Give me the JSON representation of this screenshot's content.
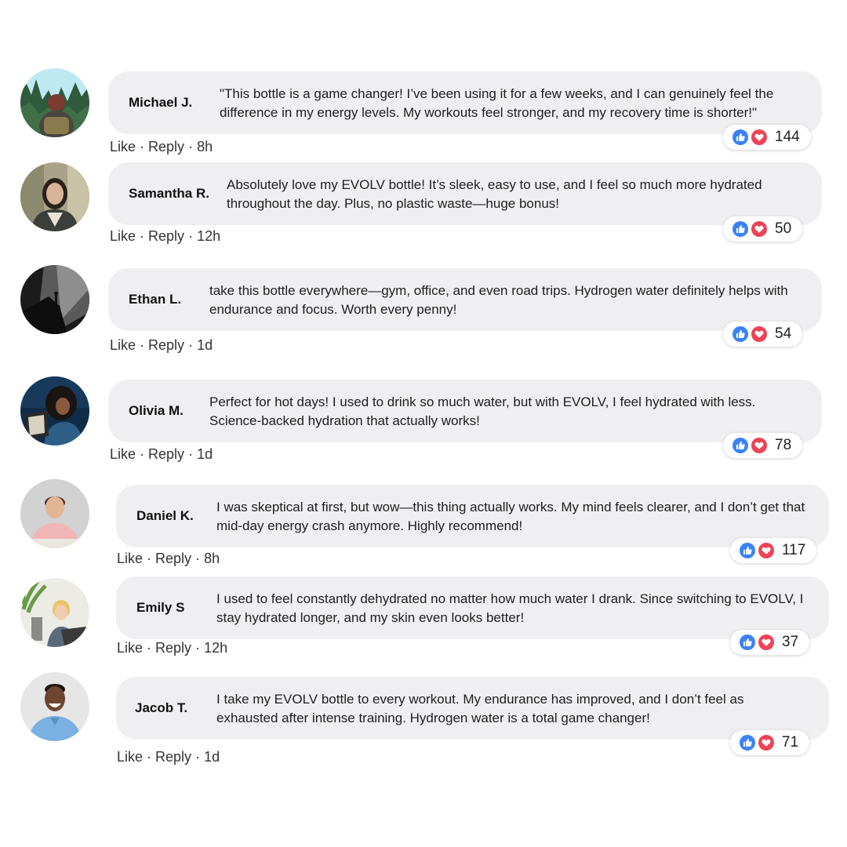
{
  "colors": {
    "bubble": "#efeff1",
    "like": "#3b82f6",
    "heart": "#ef4256"
  },
  "comments": [
    {
      "name": "Michael J.",
      "text": "\"This bottle is a game changer! I’ve been using it for a few weeks, and I can genuinely feel the difference in my energy levels. My workouts feel stronger, and my recovery time is shorter!\"",
      "like": "Like",
      "reply": "Reply",
      "time": "8h",
      "reactions": 144,
      "avatar": "hiker-avatar"
    },
    {
      "name": "Samantha R.",
      "text": "Absolutely love my EVOLV bottle! It’s sleek, easy to use, and I feel so much more hydrated throughout the day. Plus, no plastic waste—huge bonus!",
      "like": "Like",
      "reply": "Reply",
      "time": "12h",
      "reactions": 50,
      "avatar": "woman-portrait-avatar"
    },
    {
      "name": "Ethan L.",
      "text": "take this bottle everywhere—gym, office, and even road trips. Hydrogen water definitely helps with endurance and focus. Worth every penny!",
      "like": "Like",
      "reply": "Reply",
      "time": "1d",
      "reactions": 54,
      "avatar": "dark-silhouette-avatar"
    },
    {
      "name": "Olivia M.",
      "text": "Perfect for hot days! I used to drink so much water, but with EVOLV, I feel hydrated with less. Science-backed hydration that actually works!",
      "like": "Like",
      "reply": "Reply",
      "time": "1d",
      "reactions": 78,
      "avatar": "reader-avatar"
    },
    {
      "name": "Daniel K.",
      "text": "I was skeptical at first, but wow—this thing actually works. My mind feels clearer, and I don’t get that mid-day energy crash anymore. Highly recommend!",
      "like": "Like",
      "reply": "Reply",
      "time": "8h",
      "reactions": 117,
      "avatar": "smiling-man-avatar"
    },
    {
      "name": "Emily S",
      "text": "I used to feel constantly dehydrated no matter how much water I drank. Since switching to EVOLV, I stay hydrated longer, and my skin even looks better!",
      "like": "Like",
      "reply": "Reply",
      "time": "12h",
      "reactions": 37,
      "avatar": "woman-laptop-avatar"
    },
    {
      "name": "Jacob T.",
      "text": "I take my EVOLV bottle to every workout. My endurance has improved, and I don’t feel as exhausted after intense training. Hydrogen water is a total game changer!",
      "like": "Like",
      "reply": "Reply",
      "time": "1d",
      "reactions": 71,
      "avatar": "laughing-man-avatar"
    }
  ]
}
